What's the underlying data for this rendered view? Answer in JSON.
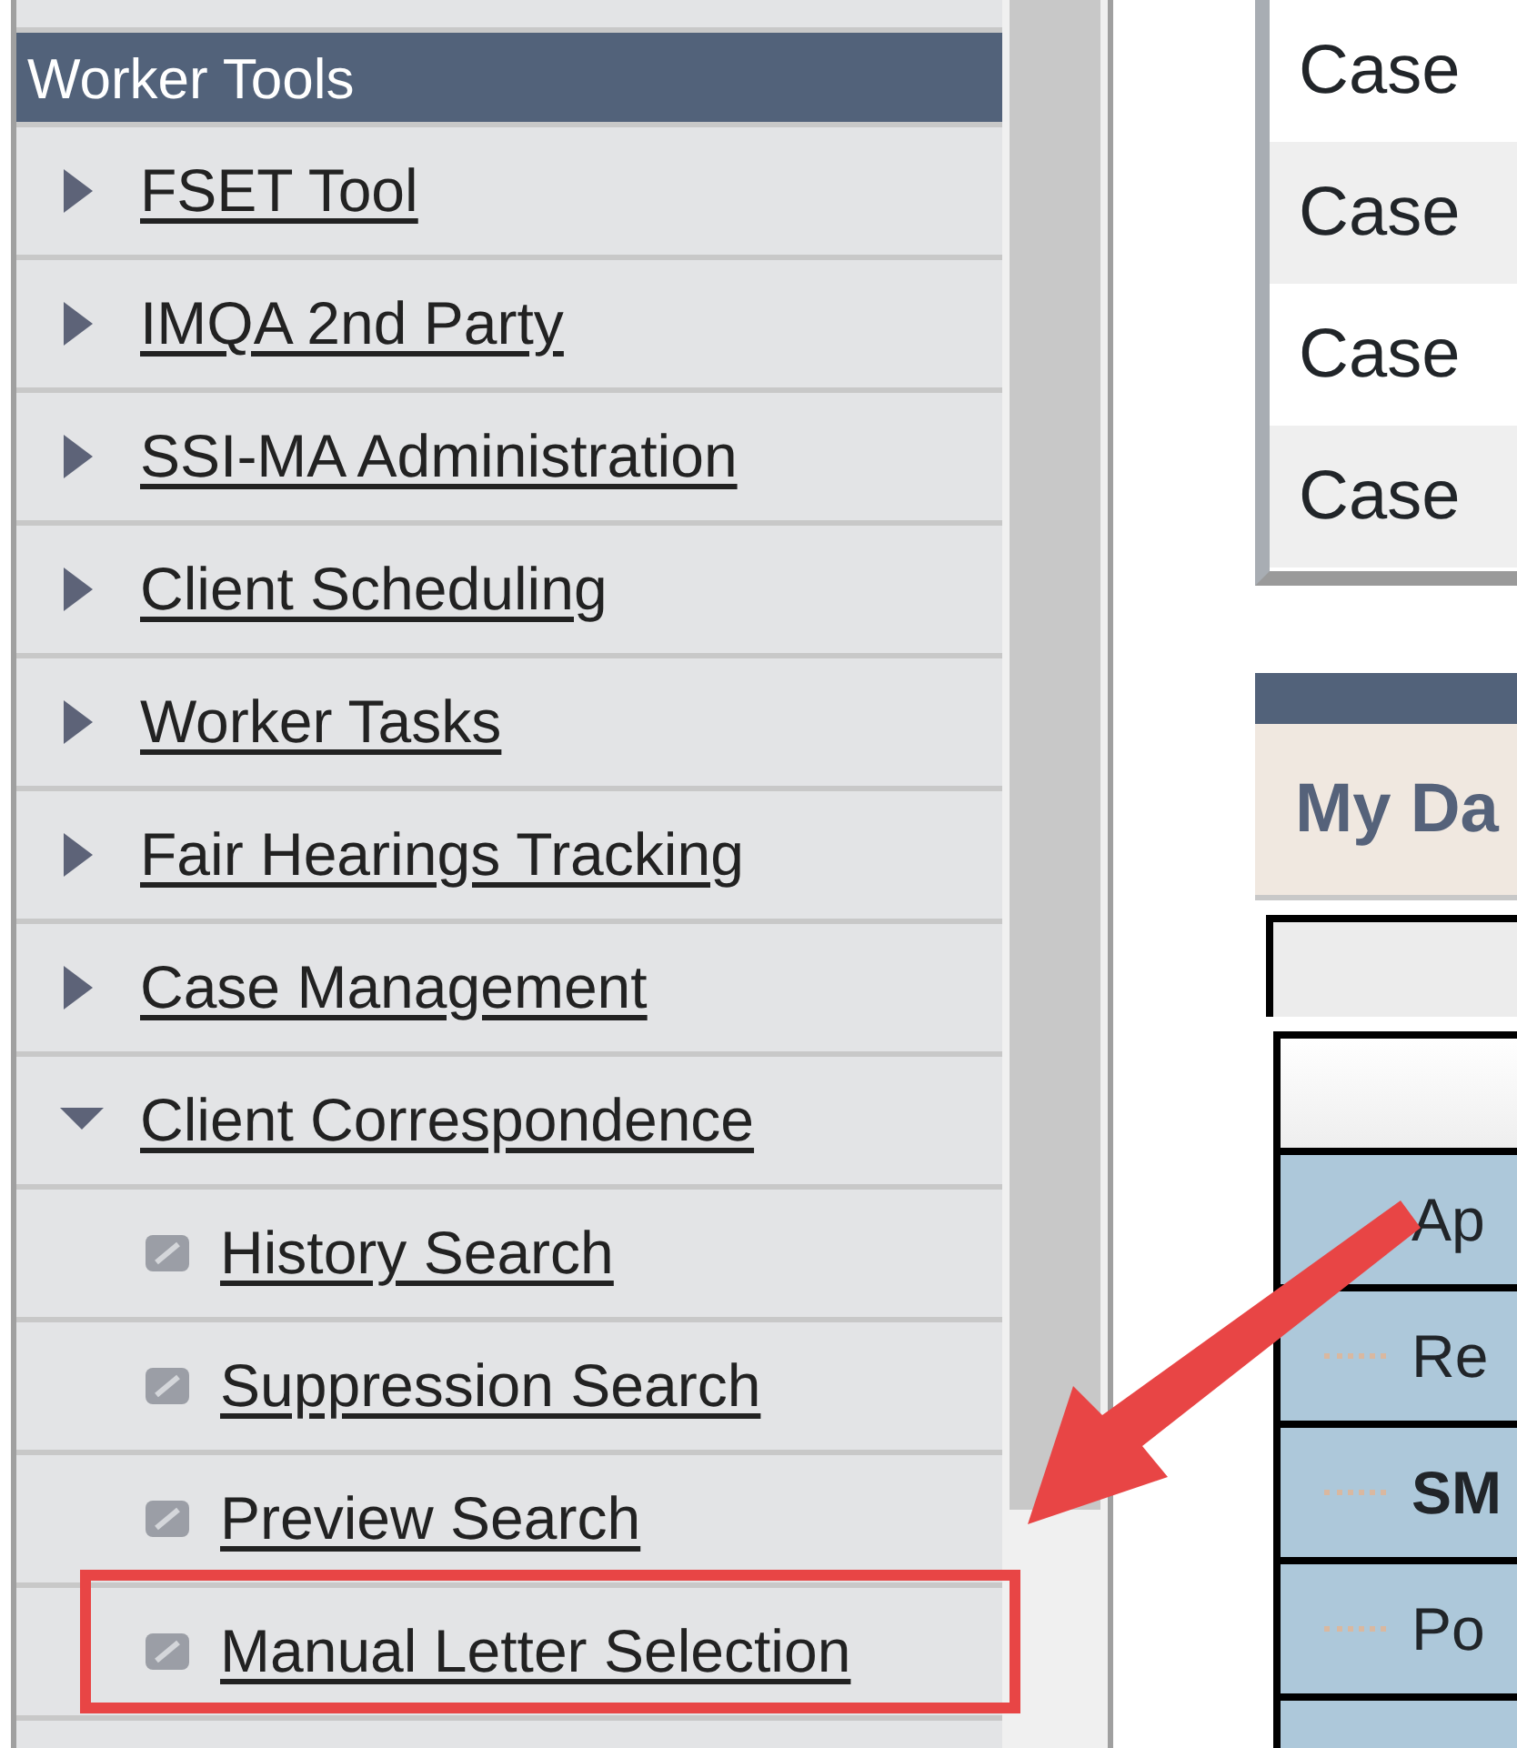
{
  "menu": {
    "title": "Worker Tools",
    "items": [
      {
        "label": "FSET Tool",
        "expanded": false
      },
      {
        "label": "IMQA 2nd Party",
        "expanded": false
      },
      {
        "label": "SSI-MA Administration",
        "expanded": false
      },
      {
        "label": "Client Scheduling",
        "expanded": false
      },
      {
        "label": "Worker Tasks",
        "expanded": false
      },
      {
        "label": "Fair Hearings Tracking",
        "expanded": false
      },
      {
        "label": "Case Management",
        "expanded": false
      },
      {
        "label": "Client Correspondence",
        "expanded": true,
        "children": [
          {
            "label": "History Search"
          },
          {
            "label": "Suppression Search"
          },
          {
            "label": "Preview Search"
          },
          {
            "label": "Manual Letter Selection"
          }
        ]
      }
    ]
  },
  "case_list": [
    "Case",
    "Case",
    "Case",
    "Case"
  ],
  "dashboard": {
    "title": "My Da",
    "tree": [
      {
        "label": "Ap",
        "bold": false,
        "children": [
          {
            "label": "Re",
            "bold": false
          },
          {
            "label": "SM",
            "bold": true
          },
          {
            "label": "Po",
            "bold": false
          }
        ]
      }
    ]
  }
}
